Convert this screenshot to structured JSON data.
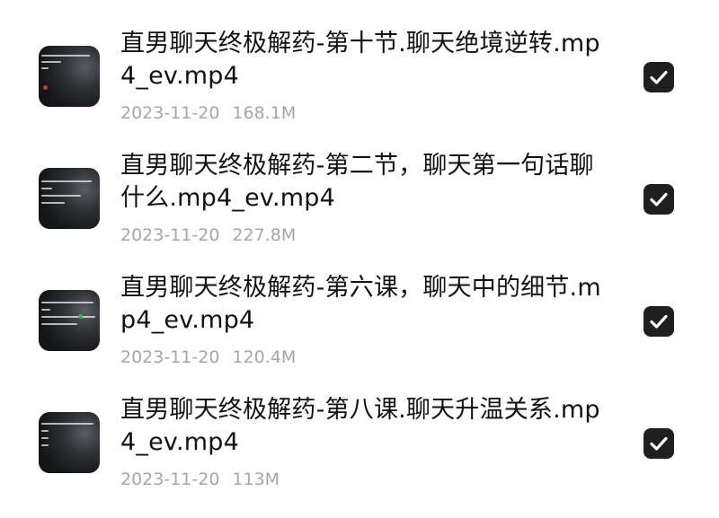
{
  "files": [
    {
      "name": "直男聊天终极解药-第十节.聊天绝境逆转.mp4_ev.mp4",
      "date": "2023-11-20",
      "size": "168.1M",
      "selected": true
    },
    {
      "name": "直男聊天终极解药-第二节，聊天第一句话聊什么.mp4_ev.mp4",
      "date": "2023-11-20",
      "size": "227.8M",
      "selected": true
    },
    {
      "name": "直男聊天终极解药-第六课，聊天中的细节.mp4_ev.mp4",
      "date": "2023-11-20",
      "size": "120.4M",
      "selected": true
    },
    {
      "name": "直男聊天终极解药-第八课.聊天升温关系.mp4_ev.mp4",
      "date": "2023-11-20",
      "size": "113M",
      "selected": true
    }
  ],
  "icons": {
    "thumbnail": "video-thumbnail-icon",
    "checkbox": "checkbox-checked-icon"
  },
  "colors": {
    "checkbox_fill": "#1f1f1f",
    "title_text": "#111111",
    "meta_text": "#a6a6a6"
  }
}
